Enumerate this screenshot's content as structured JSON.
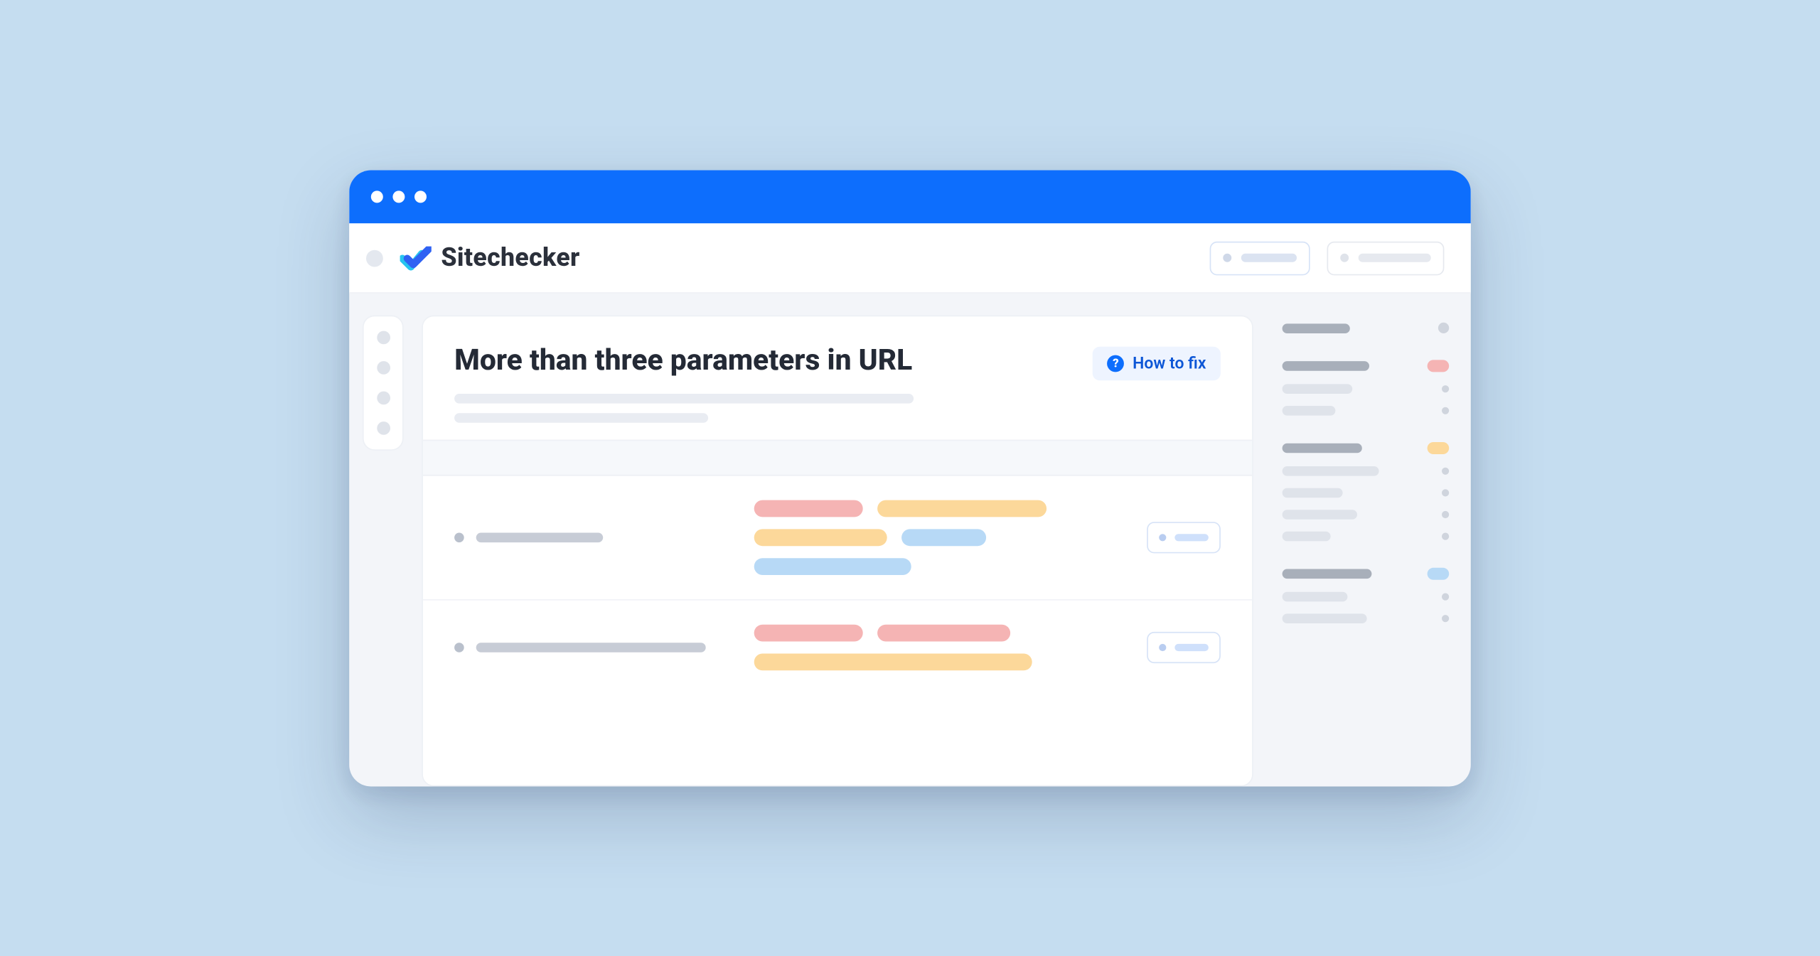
{
  "brand": "Sitechecker",
  "page_title": "More than three parameters in URL",
  "how_to_fix_label": "How to fix"
}
